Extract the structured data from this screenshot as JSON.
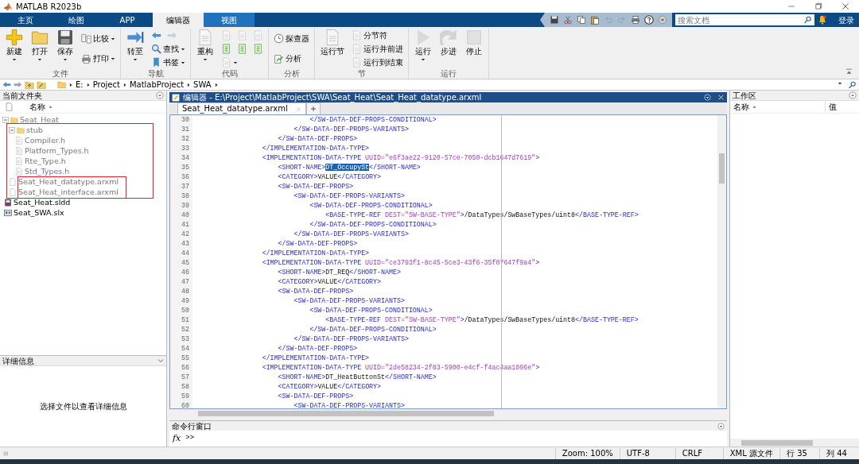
{
  "window": {
    "title": "MATLAB R2023b"
  },
  "tabs": [
    {
      "label": "主页",
      "selected": false,
      "hovered": false
    },
    {
      "label": "绘图",
      "selected": false,
      "hovered": false
    },
    {
      "label": "APP",
      "selected": false,
      "hovered": false
    },
    {
      "label": "编辑器",
      "selected": true,
      "hovered": false
    },
    {
      "label": "视图",
      "selected": false,
      "hovered": true
    }
  ],
  "search": {
    "placeholder": "搜索文档"
  },
  "sign_in": "登录",
  "ribbon": [
    {
      "label": "文件",
      "columns": [
        {
          "kind": "large",
          "item": {
            "label": "新建",
            "dropdown": true,
            "disabled": false
          }
        },
        {
          "kind": "large",
          "item": {
            "label": "打开",
            "dropdown": true,
            "disabled": false
          }
        },
        {
          "kind": "large",
          "item": {
            "label": "保存",
            "dropdown": true,
            "disabled": false
          }
        },
        {
          "kind": "stack",
          "rows": [
            [
              {
                "label": "比较",
                "dropdown": true,
                "disabled": false
              }
            ],
            [
              {
                "label": "打印",
                "dropdown": true,
                "disabled": false
              }
            ]
          ]
        }
      ]
    },
    {
      "label": "导航",
      "columns": [
        {
          "kind": "large",
          "item": {
            "label": "转至",
            "dropdown": true,
            "disabled": false
          }
        },
        {
          "kind": "stack",
          "rows": [
            [
              {
                "dropdown": false,
                "disabled": false
              },
              {
                "dropdown": false,
                "disabled": true
              }
            ],
            [
              {
                "label": "查找",
                "dropdown": true,
                "disabled": false
              }
            ],
            [
              {
                "label": "书签",
                "dropdown": true,
                "disabled": false
              }
            ]
          ]
        }
      ]
    },
    {
      "label": "代码",
      "columns": [
        {
          "kind": "large",
          "item": {
            "label": "重构",
            "dropdown": true,
            "disabled": true
          }
        },
        {
          "kind": "stack",
          "rows": [
            [
              {
                "dropdown": false,
                "disabled": true
              },
              {
                "dropdown": false,
                "disabled": true
              },
              {
                "dropdown": false,
                "disabled": true
              }
            ],
            [
              {
                "dropdown": false,
                "disabled": false
              },
              {
                "dropdown": false,
                "disabled": false
              },
              {
                "dropdown": false,
                "disabled": false
              }
            ],
            [
              {
                "dropdown": true,
                "disabled": true
              }
            ]
          ]
        }
      ]
    },
    {
      "label": "分析",
      "columns": [
        {
          "kind": "stack",
          "rows": [
            [
              {
                "label": "探查器",
                "dropdown": false,
                "disabled": false
              }
            ],
            [
              {
                "label": "分析",
                "dropdown": false,
                "disabled": false
              }
            ]
          ]
        }
      ]
    },
    {
      "label": "节",
      "columns": [
        {
          "kind": "large",
          "item": {
            "label": "运行节",
            "dropdown": false,
            "disabled": true
          }
        },
        {
          "kind": "stack",
          "rows": [
            [
              {
                "label": "分节符",
                "dropdown": false,
                "disabled": true
              }
            ],
            [
              {
                "label": "运行并前进",
                "dropdown": false,
                "disabled": true
              }
            ],
            [
              {
                "label": "运行到结束",
                "dropdown": false,
                "disabled": true
              }
            ]
          ]
        }
      ]
    },
    {
      "label": "运行",
      "columns": [
        {
          "kind": "large",
          "item": {
            "label": "运行",
            "dropdown": true,
            "disabled": true
          }
        },
        {
          "kind": "large",
          "item": {
            "label": "步进",
            "dropdown": false,
            "disabled": true
          }
        },
        {
          "kind": "large",
          "item": {
            "label": "停止",
            "dropdown": false,
            "disabled": true
          }
        }
      ]
    }
  ],
  "address": {
    "segments": [
      "E:",
      "Project",
      "MatlabProject",
      "SWA"
    ]
  },
  "files": {
    "title": "当前文件夹",
    "column": "名称",
    "tree": [
      {
        "label": "Seat_Heat",
        "kind": "folder",
        "expanded": true,
        "dimmed": true,
        "children": [
          {
            "label": "stub",
            "kind": "folder",
            "expanded": true,
            "dimmed": true,
            "children": [
              {
                "label": "Compiler.h",
                "kind": "header",
                "dimmed": true
              },
              {
                "label": "Platform_Types.h",
                "kind": "header",
                "dimmed": true
              },
              {
                "label": "Rte_Type.h",
                "kind": "header",
                "dimmed": true
              },
              {
                "label": "Std_Types.h",
                "kind": "header",
                "dimmed": true
              }
            ]
          },
          {
            "label": "Seat_Heat_datatype.arxml",
            "kind": "file",
            "dimmed": true
          },
          {
            "label": "Seat_Heat_interface.arxml",
            "kind": "file",
            "dimmed": true
          }
        ]
      },
      {
        "label": "Seat_Heat.sldd",
        "kind": "dictionary",
        "dimmed": false
      },
      {
        "label": "Seat_SWA.slx",
        "kind": "model",
        "dimmed": false
      }
    ]
  },
  "details": {
    "title": "详细信息",
    "message": "选择文件以查看详细信息"
  },
  "editor": {
    "title": "编辑器 - E:\\Project\\MatlabProject\\SWA\\Seat_Heat\\Seat_Heat_datatype.arxml",
    "tabs": [
      {
        "label": "Seat_Heat_datatype.arxml",
        "selected": true
      }
    ],
    "lines": [
      {
        "number": "30",
        "segments": [
          {
            "kind": "tag",
            "text": "                            </SW-DATA-DEF-PROPS-CONDITIONAL>"
          }
        ]
      },
      {
        "number": "31",
        "segments": [
          {
            "kind": "tag",
            "text": "                        </SW-DATA-DEF-PROPS-VARIANTS>"
          }
        ]
      },
      {
        "number": "32",
        "segments": [
          {
            "kind": "tag",
            "text": "                    </SW-DATA-DEF-PROPS>"
          }
        ]
      },
      {
        "number": "33",
        "segments": [
          {
            "kind": "tag",
            "text": "                </IMPLEMENTATION-DATA-TYPE>"
          }
        ]
      },
      {
        "number": "34",
        "segments": [
          {
            "kind": "tag",
            "text": "                <IMPLEMENTATION-DATA-TYPE"
          },
          {
            "kind": "attr",
            "text": " UUID=\"e6f3ae22-9120-57ce-7050-dcb1647d7619\""
          },
          {
            "kind": "tag",
            "text": ">"
          }
        ]
      },
      {
        "number": "35",
        "segments": [
          {
            "kind": "tag",
            "text": "                    <SHORT-NAME>"
          },
          {
            "kind": "selection",
            "text": "DT_OccupySt"
          },
          {
            "kind": "tag",
            "text": "</SHORT-NAME>"
          }
        ]
      },
      {
        "number": "36",
        "segments": [
          {
            "kind": "tag",
            "text": "                    <CATEGORY>"
          },
          {
            "kind": "text",
            "text": "VALUE"
          },
          {
            "kind": "tag",
            "text": "</CATEGORY>"
          }
        ]
      },
      {
        "number": "37",
        "segments": [
          {
            "kind": "tag",
            "text": "                    <SW-DATA-DEF-PROPS>"
          }
        ]
      },
      {
        "number": "38",
        "segments": [
          {
            "kind": "tag",
            "text": "                        <SW-DATA-DEF-PROPS-VARIANTS>"
          }
        ]
      },
      {
        "number": "39",
        "segments": [
          {
            "kind": "tag",
            "text": "                            <SW-DATA-DEF-PROPS-CONDITIONAL>"
          }
        ]
      },
      {
        "number": "40",
        "segments": [
          {
            "kind": "tag",
            "text": "                                <BASE-TYPE-REF"
          },
          {
            "kind": "attr",
            "text": " DEST=\"SW-BASE-TYPE\""
          },
          {
            "kind": "tag",
            "text": ">"
          },
          {
            "kind": "text",
            "text": "/DataTypes/SwBaseTypes/uint8"
          },
          {
            "kind": "tag",
            "text": "</BASE-TYPE-REF>"
          }
        ]
      },
      {
        "number": "41",
        "segments": [
          {
            "kind": "tag",
            "text": "                            </SW-DATA-DEF-PROPS-CONDITIONAL>"
          }
        ]
      },
      {
        "number": "42",
        "segments": [
          {
            "kind": "tag",
            "text": "                        </SW-DATA-DEF-PROPS-VARIANTS>"
          }
        ]
      },
      {
        "number": "43",
        "segments": [
          {
            "kind": "tag",
            "text": "                    </SW-DATA-DEF-PROPS>"
          }
        ]
      },
      {
        "number": "44",
        "segments": [
          {
            "kind": "tag",
            "text": "                </IMPLEMENTATION-DATA-TYPE>"
          }
        ]
      },
      {
        "number": "45",
        "segments": [
          {
            "kind": "tag",
            "text": "                <IMPLEMENTATION-DATA-TYPE"
          },
          {
            "kind": "attr",
            "text": " UUID=\"ce3793f1-8c45-5ce3-43f6-35f07647f9a4\""
          },
          {
            "kind": "tag",
            "text": ">"
          }
        ]
      },
      {
        "number": "46",
        "segments": [
          {
            "kind": "tag",
            "text": "                    <SHORT-NAME>"
          },
          {
            "kind": "text",
            "text": "DT_REQ"
          },
          {
            "kind": "tag",
            "text": "</SHORT-NAME>"
          }
        ]
      },
      {
        "number": "47",
        "segments": [
          {
            "kind": "tag",
            "text": "                    <CATEGORY>"
          },
          {
            "kind": "text",
            "text": "VALUE"
          },
          {
            "kind": "tag",
            "text": "</CATEGORY>"
          }
        ]
      },
      {
        "number": "48",
        "segments": [
          {
            "kind": "tag",
            "text": "                    <SW-DATA-DEF-PROPS>"
          }
        ]
      },
      {
        "number": "49",
        "segments": [
          {
            "kind": "tag",
            "text": "                        <SW-DATA-DEF-PROPS-VARIANTS>"
          }
        ]
      },
      {
        "number": "50",
        "segments": [
          {
            "kind": "tag",
            "text": "                            <SW-DATA-DEF-PROPS-CONDITIONAL>"
          }
        ]
      },
      {
        "number": "51",
        "segments": [
          {
            "kind": "tag",
            "text": "                                <BASE-TYPE-REF"
          },
          {
            "kind": "attr",
            "text": " DEST=\"SW-BASE-TYPE\""
          },
          {
            "kind": "tag",
            "text": ">"
          },
          {
            "kind": "text",
            "text": "/DataTypes/SwBaseTypes/uint8"
          },
          {
            "kind": "tag",
            "text": "</BASE-TYPE-REF>"
          }
        ]
      },
      {
        "number": "52",
        "segments": [
          {
            "kind": "tag",
            "text": "                            </SW-DATA-DEF-PROPS-CONDITIONAL>"
          }
        ]
      },
      {
        "number": "53",
        "segments": [
          {
            "kind": "tag",
            "text": "                        </SW-DATA-DEF-PROPS-VARIANTS>"
          }
        ]
      },
      {
        "number": "54",
        "segments": [
          {
            "kind": "tag",
            "text": "                    </SW-DATA-DEF-PROPS>"
          }
        ]
      },
      {
        "number": "55",
        "segments": [
          {
            "kind": "tag",
            "text": "                </IMPLEMENTATION-DATA-TYPE>"
          }
        ]
      },
      {
        "number": "56",
        "segments": [
          {
            "kind": "tag",
            "text": "                <IMPLEMENTATION-DATA-TYPE"
          },
          {
            "kind": "attr",
            "text": " UUID=\"2de58234-2f83-5900-e4cf-f4ac4aa1096e\""
          },
          {
            "kind": "tag",
            "text": ">"
          }
        ]
      },
      {
        "number": "57",
        "segments": [
          {
            "kind": "tag",
            "text": "                    <SHORT-NAME>"
          },
          {
            "kind": "text",
            "text": "DT_HeatButtonSt"
          },
          {
            "kind": "tag",
            "text": "</SHORT-NAME>"
          }
        ]
      },
      {
        "number": "58",
        "segments": [
          {
            "kind": "tag",
            "text": "                    <CATEGORY>"
          },
          {
            "kind": "text",
            "text": "VALUE"
          },
          {
            "kind": "tag",
            "text": "</CATEGORY>"
          }
        ]
      },
      {
        "number": "59",
        "segments": [
          {
            "kind": "tag",
            "text": "                    <SW-DATA-DEF-PROPS>"
          }
        ]
      },
      {
        "number": "60",
        "segments": [
          {
            "kind": "tag",
            "text": "                        <SW-DATA-DEF-PROPS-VARIANTS>"
          }
        ]
      }
    ]
  },
  "command_window": {
    "title": "命令行窗口",
    "function_button": "fx",
    "prompt": ">>"
  },
  "workspace": {
    "title": "工作区",
    "columns": [
      "名称",
      "值"
    ]
  },
  "status_bar": [
    "Zoom: 100%",
    "UTF-8",
    "CRLF",
    "XML 源文件",
    "行 35",
    "列 44"
  ]
}
